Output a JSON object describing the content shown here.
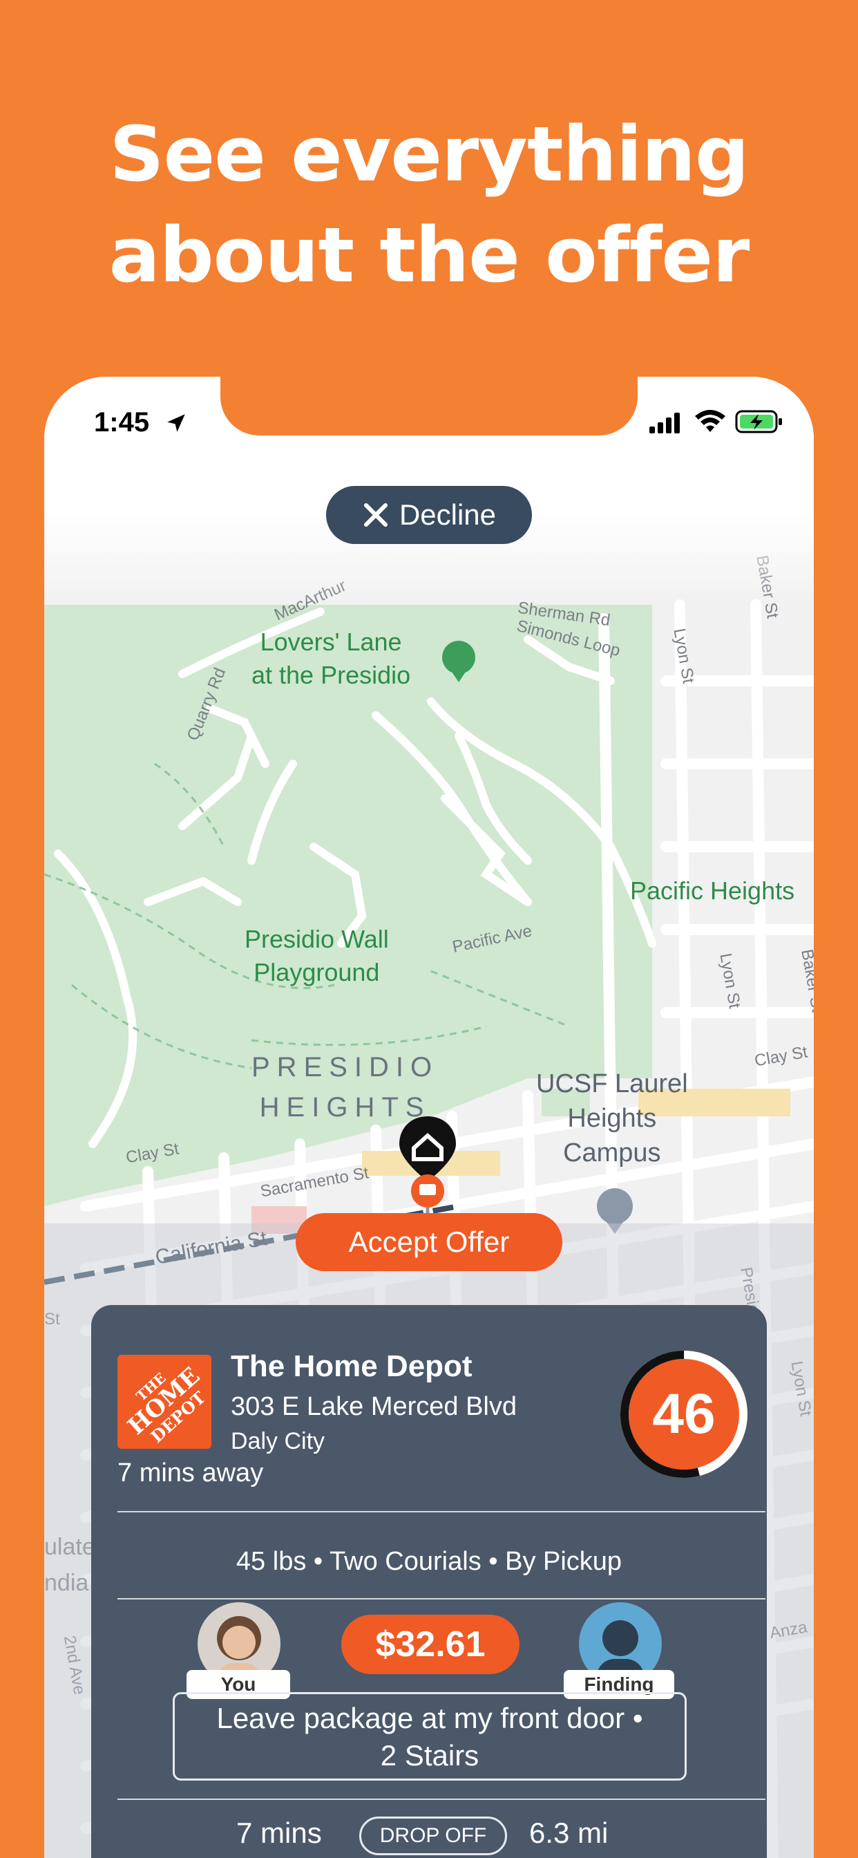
{
  "hero": {
    "line1": "See everything",
    "line2": "about the offer"
  },
  "status_bar": {
    "time": "1:45",
    "icons": [
      "location-arrow-icon",
      "cellular-signal-icon",
      "wifi-icon",
      "battery-charging-icon"
    ]
  },
  "actions": {
    "decline_label": "Decline",
    "accept_label": "Accept Offer"
  },
  "map": {
    "labels": {
      "lovers_lane_1": "Lovers' Lane",
      "lovers_lane_2": "at the Presidio",
      "pacific_heights": "Pacific Heights",
      "presidio_wall_1": "Presidio Wall",
      "presidio_wall_2": "Playground",
      "district_1": "PRESIDIO",
      "district_2": "HEIGHTS",
      "ucsf_1": "UCSF Laurel",
      "ucsf_2": "Heights",
      "ucsf_3": "Campus",
      "macarthur": "MacArthur",
      "quarry_rd": "Quarry Rd",
      "sherman_rd": "Sherman Rd",
      "simonds_loop": "Simonds Loop",
      "lyon_st_top": "Lyon St",
      "baker_st_top": "Baker St",
      "pacific_ave": "Pacific Ave",
      "lyon_st_mid": "Lyon St",
      "baker_st_mid": "Baker St",
      "clay_st_right": "Clay St",
      "clay_st_left": "Clay St",
      "sacramento_st": "Sacramento St",
      "california_st": "California St",
      "presidio_ave": "Presidio Ave",
      "lyon_st_bottom": "Lyon St",
      "second_ave": "2nd Ave",
      "anza": "Anza",
      "st_left": "St",
      "ulate": "ulate",
      "ndia": "ndia"
    }
  },
  "offer": {
    "store_name": "The Home Depot",
    "store_logo_text": "THE HOME DEPOT",
    "address": "303 E Lake Merced Blvd",
    "city": "Daly City",
    "eta": "7 mins away",
    "score": "46",
    "score_fraction": 0.46,
    "details": "45 lbs • Two Courials • By Pickup",
    "customer_tag": "You",
    "courier_tag": "Finding",
    "price": "$32.61",
    "note_line1": "Leave package at my front door •",
    "note_line2": "2 Stairs",
    "trip_time": "7 mins",
    "trip_type": "DROP OFF",
    "trip_distance": "6.3 mi"
  },
  "colors": {
    "brand_orange": "#F48031",
    "accept_orange": "#F05A24",
    "card_slate": "#4A586A",
    "decline_navy": "#384B5F",
    "park_green": "#CFE8CF"
  }
}
